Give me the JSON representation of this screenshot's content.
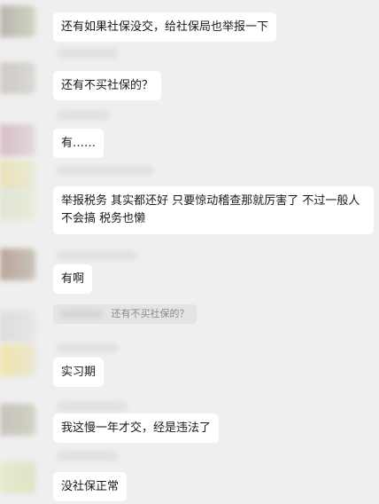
{
  "messages": [
    {
      "text": "还有如果社保没交，给社保局也举报一下"
    },
    {
      "text": "还有不买社保的？"
    },
    {
      "text": "有……"
    },
    {
      "text": "举报税务  其实都还好 只要惊动稽查那就厉害了  不过一般人不会搞 税务也懒"
    },
    {
      "text": "有啊"
    },
    {
      "text": "实习期"
    },
    {
      "text": "我这慢一年才交，经是违法了"
    },
    {
      "text": "没社保正常"
    }
  ],
  "quote": {
    "text": "还有不买社保的？"
  },
  "colors": {
    "background": "#efefef",
    "bubble": "#ffffff",
    "quote_bg": "#e4e4e4",
    "quote_text": "#8a8a8a"
  }
}
